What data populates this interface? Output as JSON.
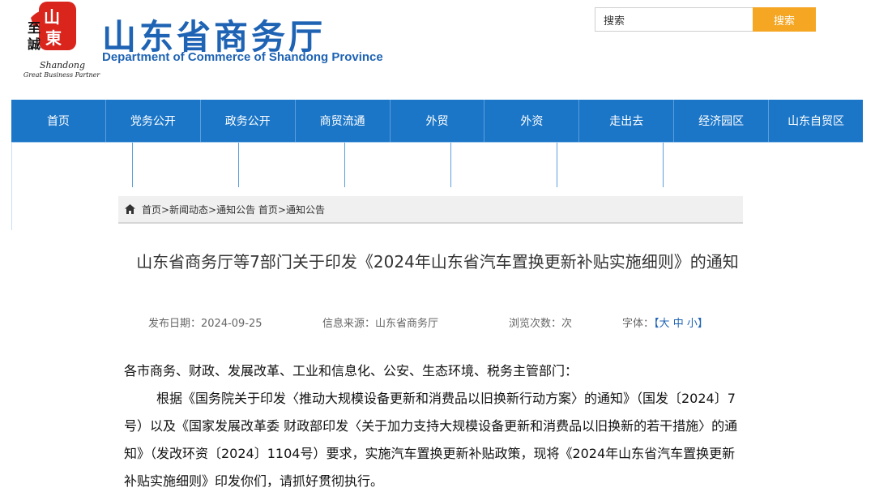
{
  "header": {
    "logo_stamp_chars": "至诚山東",
    "logo_en_line1": "Shandong",
    "logo_en_line2": "Great Business Partner",
    "title": "山东省商务厅",
    "subtitle": "Department of Commerce of Shandong Province",
    "search_placeholder": "搜索",
    "search_button": "搜索",
    "colors": {
      "brand_blue": "#1e63b4",
      "search_button": "#f5a623"
    }
  },
  "nav": {
    "items": [
      "首页",
      "党务公开",
      "政务公开",
      "商贸流通",
      "外贸",
      "外资",
      "走出去",
      "经济园区",
      "山东自贸区"
    ],
    "color": "#1b76c8"
  },
  "breadcrumb": {
    "icon": "home-icon",
    "text": "首页>新闻动态>通知公告 首页>通知公告"
  },
  "article": {
    "title": "山东省商务厅等7部门关于印发《2024年山东省汽车置换更新补贴实施细则》的通知",
    "meta": {
      "date_label": "发布日期：",
      "date": "2024-09-25",
      "source_label": "信息来源：",
      "source": "山东省商务厅",
      "views_label": "浏览次数：",
      "views_unit": "次",
      "font_label": "字体：",
      "font_open": "【",
      "font_large": "大",
      "font_medium": "中",
      "font_small": "小",
      "font_close": "】"
    },
    "salutation": "各市商务、财政、发展改革、工业和信息化、公安、生态环境、税务主管部门：",
    "paragraph": "根据《国务院关于印发〈推动大规模设备更新和消费品以旧换新行动方案〉的通知》（国发〔2024〕7号）以及《国家发展改革委 财政部印发〈关于加力支持大规模设备更新和消费品以旧换新的若干措施〉的通知》（发改环资〔2024〕1104号）要求，实施汽车置换更新补贴政策，现将《2024年山东省汽车置换更新补贴实施细则》印发你们，请抓好贯彻执行。"
  }
}
